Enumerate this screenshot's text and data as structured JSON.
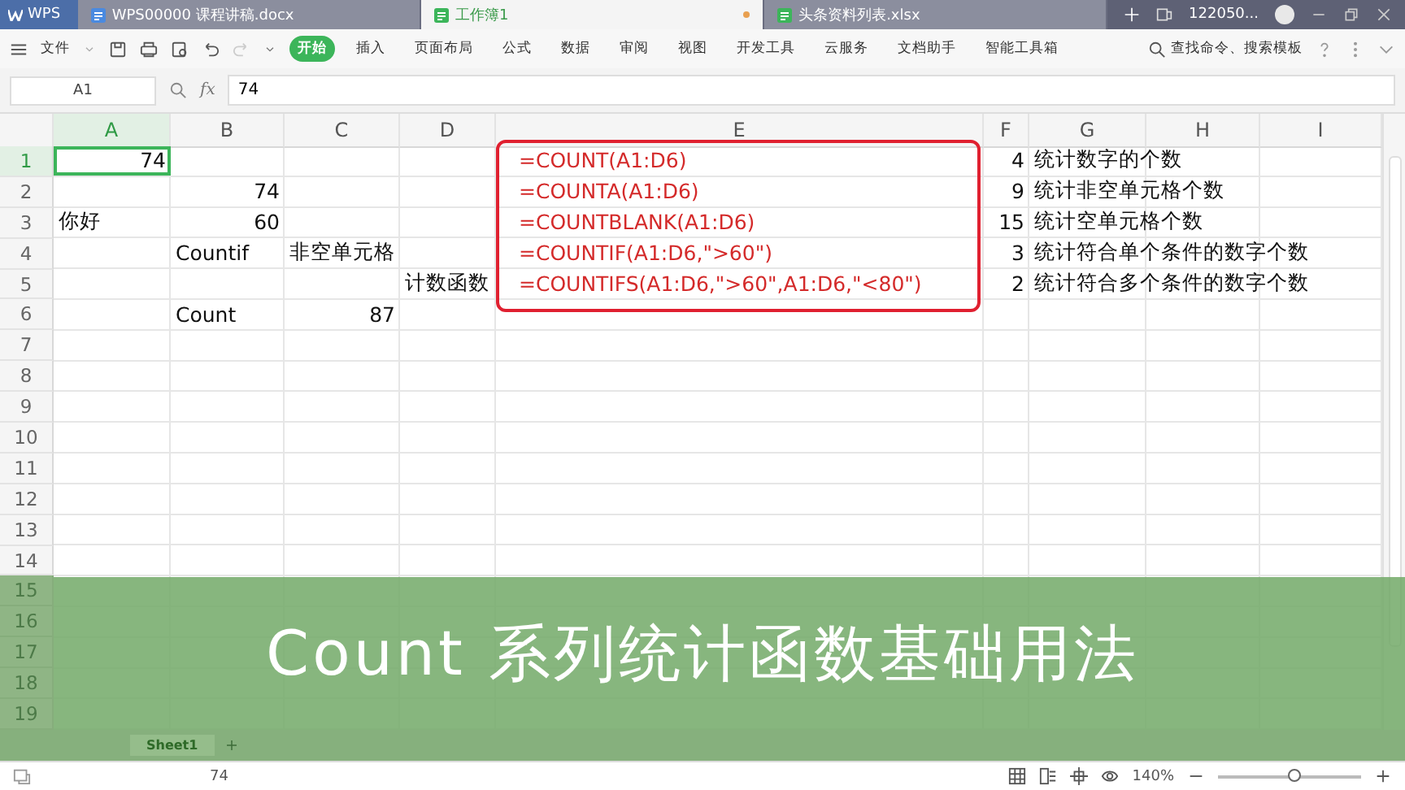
{
  "title_bar": {
    "app": "WPS",
    "tabs": [
      {
        "label": "WPS00000 课程讲稿.docx",
        "kind": "doc",
        "selected": false
      },
      {
        "label": "工作簿1",
        "kind": "sheet",
        "selected": true
      },
      {
        "label": "头条资料列表.xlsx",
        "kind": "sheet",
        "selected": false
      }
    ],
    "user": "122050..."
  },
  "toolbar": {
    "file_menu": "文件",
    "menu_items": [
      {
        "label": "开始",
        "selected": true
      },
      {
        "label": "插入",
        "selected": false
      },
      {
        "label": "页面布局",
        "selected": false
      },
      {
        "label": "公式",
        "selected": false
      },
      {
        "label": "数据",
        "selected": false
      },
      {
        "label": "审阅",
        "selected": false
      },
      {
        "label": "视图",
        "selected": false
      },
      {
        "label": "开发工具",
        "selected": false
      },
      {
        "label": "云服务",
        "selected": false
      },
      {
        "label": "文档助手",
        "selected": false
      },
      {
        "label": "智能工具箱",
        "selected": false
      }
    ],
    "search": {
      "placeholder": "查找命令、搜索模板"
    }
  },
  "formula_bar": {
    "name_box": "A1",
    "fx": "fx",
    "value": "74"
  },
  "sheet": {
    "columns": [
      "A",
      "B",
      "C",
      "D",
      "E",
      "F",
      "G",
      "H",
      "I"
    ],
    "rows": [
      {
        "label": "1",
        "cells": {
          "A": {
            "text": "74",
            "kind": "number",
            "selected": true
          },
          "E": {
            "text": "=COUNT(A1:D6)",
            "kind": "formula",
            "selected": false
          },
          "F": {
            "text": "4",
            "kind": "number",
            "selected": false
          },
          "G": {
            "text": "统计数字的个数",
            "kind": "text",
            "selected": false
          }
        }
      },
      {
        "label": "2",
        "cells": {
          "B": {
            "text": "74",
            "kind": "number",
            "selected": false
          },
          "E": {
            "text": "=COUNTA(A1:D6)",
            "kind": "formula",
            "selected": false
          },
          "F": {
            "text": "9",
            "kind": "number",
            "selected": false
          },
          "G": {
            "text": "统计非空单元格个数",
            "kind": "text",
            "selected": false
          }
        }
      },
      {
        "label": "3",
        "cells": {
          "A": {
            "text": "你好",
            "kind": "text",
            "selected": false
          },
          "B": {
            "text": "60",
            "kind": "number",
            "selected": false
          },
          "E": {
            "text": "=COUNTBLANK(A1:D6)",
            "kind": "formula",
            "selected": false
          },
          "F": {
            "text": "15",
            "kind": "number",
            "selected": false
          },
          "G": {
            "text": "统计空单元格个数",
            "kind": "text",
            "selected": false
          }
        }
      },
      {
        "label": "4",
        "cells": {
          "B": {
            "text": "Countif",
            "kind": "text",
            "selected": false
          },
          "C": {
            "text": "非空单元格",
            "kind": "text",
            "selected": false
          },
          "E": {
            "text": "=COUNTIF(A1:D6,\">60\")",
            "kind": "formula",
            "selected": false
          },
          "F": {
            "text": "3",
            "kind": "number",
            "selected": false
          },
          "G": {
            "text": "统计符合单个条件的数字个数",
            "kind": "text",
            "selected": false
          }
        }
      },
      {
        "label": "5",
        "cells": {
          "D": {
            "text": "计数函数",
            "kind": "text",
            "selected": false
          },
          "E": {
            "text": "=COUNTIFS(A1:D6,\">60\",A1:D6,\"<80\")",
            "kind": "formula",
            "selected": false
          },
          "F": {
            "text": "2",
            "kind": "number",
            "selected": false
          },
          "G": {
            "text": "统计符合多个条件的数字个数",
            "kind": "text",
            "selected": false
          }
        }
      },
      {
        "label": "6",
        "cells": {
          "B": {
            "text": "Count",
            "kind": "text",
            "selected": false
          },
          "C": {
            "text": "87",
            "kind": "number",
            "selected": false
          }
        }
      },
      {
        "label": "7"
      },
      {
        "label": "8"
      },
      {
        "label": "9"
      },
      {
        "label": "10"
      },
      {
        "label": "11"
      },
      {
        "label": "12"
      },
      {
        "label": "13"
      },
      {
        "label": "14"
      },
      {
        "label": "15"
      },
      {
        "label": "16"
      },
      {
        "label": "17"
      },
      {
        "label": "18"
      },
      {
        "label": "19"
      }
    ],
    "sheet_tabs": [
      {
        "label": "Sheet1",
        "selected": true
      }
    ]
  },
  "caption": "Count 系列统计函数基础用法",
  "status_bar": {
    "value": "74",
    "zoom": "140%",
    "zoom_level": {
      "level": 0.53
    }
  }
}
